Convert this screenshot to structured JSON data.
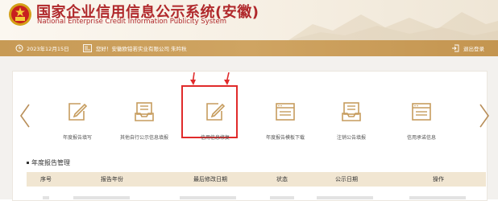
{
  "header": {
    "title": "国家企业信用信息公示系统(安徽)",
    "subtitle": "National Enterprise Credit Information Publicity System"
  },
  "statusbar": {
    "date": "2023年12月15日",
    "greeting": "您好！安徽欧铂若实业有限公司   朱吟秋",
    "logout": "退出登录"
  },
  "services": [
    {
      "label": "年度报告填写",
      "icon": "pencil-form-icon"
    },
    {
      "label": "其他自行公示信息填报",
      "icon": "inbox-tray-icon"
    },
    {
      "label": "信用信息修复",
      "icon": "pencil-form-icon"
    },
    {
      "label": "年度报告模板下载",
      "icon": "document-window-icon"
    },
    {
      "label": "注销公告填报",
      "icon": "inbox-tray-icon"
    },
    {
      "label": "信用承诺信息",
      "icon": "document-window-icon"
    }
  ],
  "section": {
    "title": "年度报告管理"
  },
  "table": {
    "headers": [
      "序号",
      "报告年份",
      "最后修改日期",
      "状态",
      "公示日期",
      "操作"
    ]
  },
  "colors": {
    "accent": "#c79a55",
    "brand": "#b0282b",
    "highlight": "#e02b2b"
  }
}
